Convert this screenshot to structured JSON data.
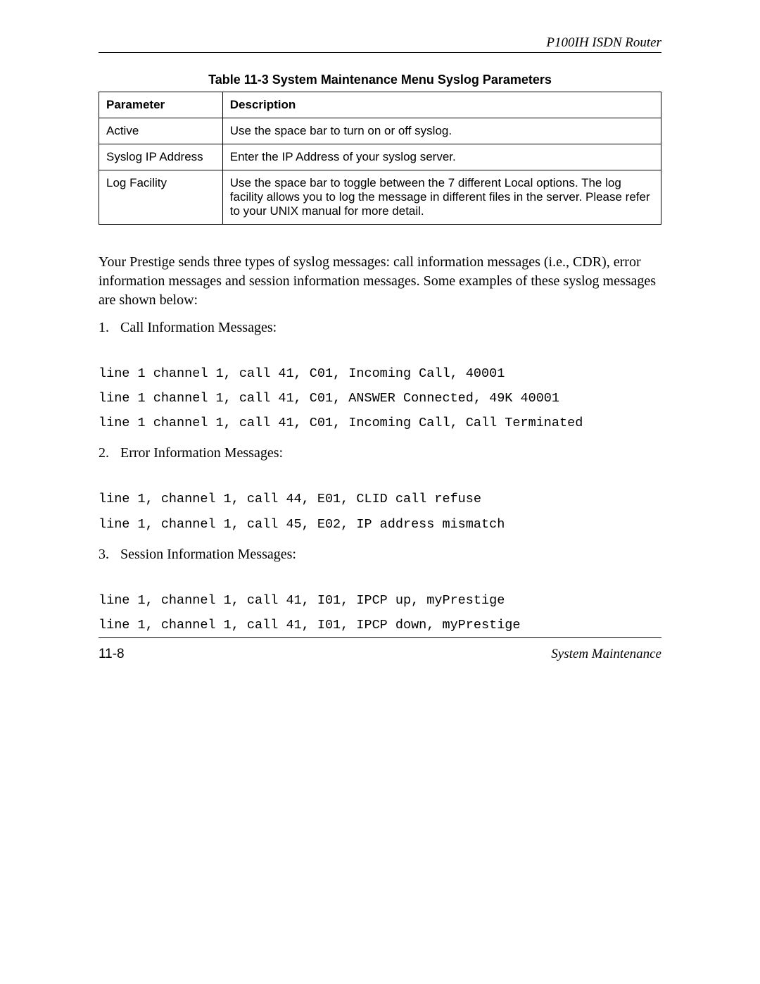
{
  "header": {
    "title": "P100IH ISDN Router"
  },
  "table": {
    "caption": "Table 11-3 System Maintenance Menu Syslog Parameters",
    "head": {
      "param": "Parameter",
      "desc": "Description"
    },
    "rows": [
      {
        "param": "Active",
        "desc": "Use the space bar to turn on or off syslog."
      },
      {
        "param": "Syslog IP Address",
        "desc": "Enter the IP Address of your syslog server."
      },
      {
        "param": "Log Facility",
        "desc": "Use the space bar to toggle between the 7 different Local options. The log facility allows you to log the message in different files in the server. Please refer to your UNIX manual for more detail."
      }
    ]
  },
  "body": {
    "intro": "Your Prestige sends three types of syslog messages: call information messages (i.e., CDR), error information messages and session information messages. Some examples of these syslog messages are shown below:",
    "items": [
      {
        "num": "1.",
        "label": "Call Information Messages:"
      },
      {
        "num": "2.",
        "label": "Error Information Messages:"
      },
      {
        "num": "3.",
        "label": "Session Information Messages:"
      }
    ],
    "code1": "line 1 channel 1, call 41, C01, Incoming Call, 40001\nline 1 channel 1, call 41, C01, ANSWER Connected, 49K 40001\nline 1 channel 1, call 41, C01, Incoming Call, Call Terminated",
    "code2": "line 1, channel 1, call 44, E01, CLID call refuse\nline 1, channel 1, call 45, E02, IP address mismatch",
    "code3": "line 1, channel 1, call 41, I01, IPCP up, myPrestige\nline 1, channel 1, call 41, I01, IPCP down, myPrestige"
  },
  "footer": {
    "left": "11-8",
    "right": "System Maintenance"
  }
}
